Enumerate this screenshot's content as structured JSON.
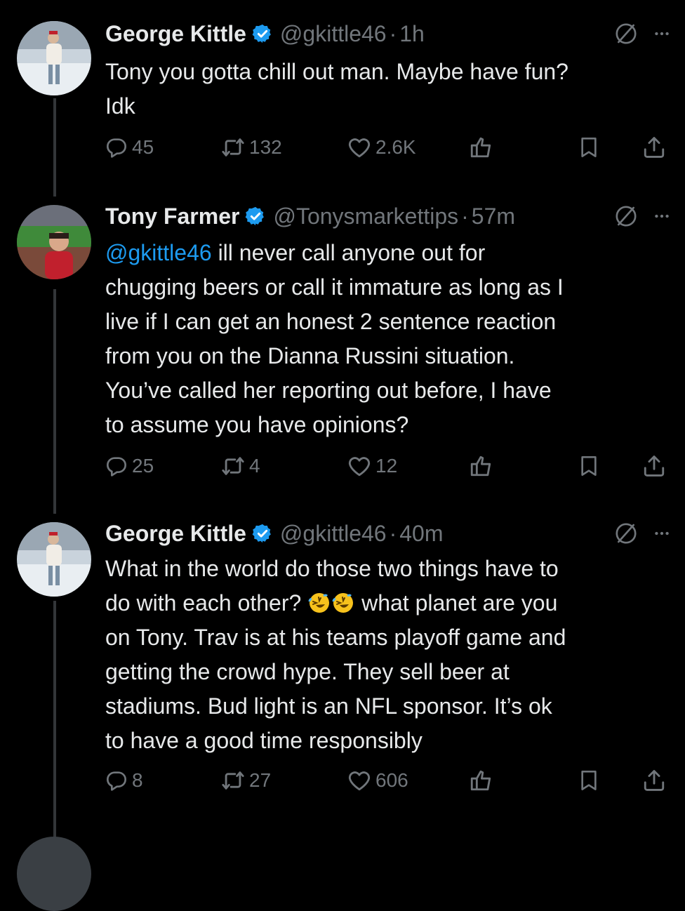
{
  "colors": {
    "background": "#000000",
    "text": "#e7e9ea",
    "muted": "#71767b",
    "accent": "#1d9bf0",
    "thread_line": "#333639"
  },
  "icons": {
    "verified": "verified-badge-icon",
    "grok": "grok-icon",
    "more": "more-icon",
    "reply": "reply-icon",
    "retweet": "retweet-icon",
    "like": "heart-icon",
    "analytics": "analytics-icon",
    "bookmark": "bookmark-icon",
    "share": "share-icon"
  },
  "tweets": [
    {
      "name": "George Kittle",
      "handle": "@gkittle46",
      "sep": "·",
      "time": "1h",
      "text_lines": [
        "Tony you gotta chill out man. Maybe have fun?",
        "Idk"
      ],
      "replies": "45",
      "retweets": "132",
      "likes": "2.6K"
    },
    {
      "name": "Tony Farmer",
      "handle": "@Tonysmarkettips",
      "sep": "·",
      "time": "57m",
      "mention": "@gkittle46",
      "text_lines": [
        " ill never call anyone out for",
        "chugging beers or call it immature as long as I",
        "live if I can get an honest 2 sentence reaction",
        "from you on the Dianna Russini situation.",
        "You’ve called her reporting out before, I have",
        "to assume you have opinions?"
      ],
      "replies": "25",
      "retweets": "4",
      "likes": "12"
    },
    {
      "name": "George Kittle",
      "handle": "@gkittle46",
      "sep": "·",
      "time": "40m",
      "text_lines": [
        "What in the world do those two things have to",
        "do with each other?",
        " what planet are you",
        "on Tony. Trav is at his teams playoff game and",
        "getting the crowd hype. They sell beer at",
        "stadiums. Bud light is an NFL sponsor. It’s ok",
        "to have a good time responsibly"
      ],
      "emoji": "rolling-on-floor-laughing-emoji",
      "replies": "8",
      "retweets": "27",
      "likes": "606"
    }
  ]
}
